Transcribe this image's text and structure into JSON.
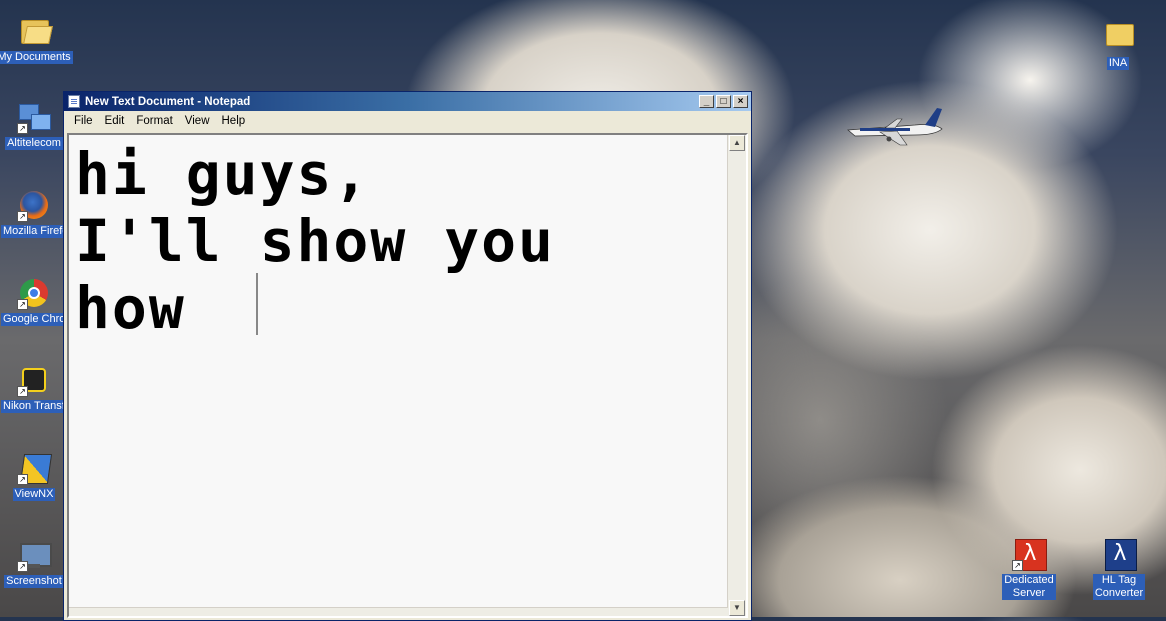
{
  "desktop": {
    "left_icons": [
      {
        "label": "My Documents",
        "icon": "folder-open-icon"
      },
      {
        "label": "Altitelecom",
        "icon": "network-icon"
      },
      {
        "label": "Mozilla Firefox",
        "icon": "firefox-icon"
      },
      {
        "label": "Google Chrome",
        "icon": "chrome-icon"
      },
      {
        "label": "Nikon Transfer",
        "icon": "nikon-transfer-icon"
      },
      {
        "label": "ViewNX",
        "icon": "viewnx-icon"
      },
      {
        "label": "Screenshot",
        "icon": "screenshot-icon"
      }
    ],
    "right_icons": [
      {
        "label": "INA",
        "icon": "folder-icon"
      },
      {
        "label_line1": "Dedicated",
        "label_line2": "Server",
        "icon": "half-life-dedicated-server-icon"
      },
      {
        "label_line1": "HL Tag",
        "label_line2": "Converter",
        "icon": "half-life-tag-converter-icon"
      }
    ]
  },
  "notepad": {
    "title": "New Text Document - Notepad",
    "window_buttons": {
      "minimize": "_",
      "maximize": "□",
      "close": "×"
    },
    "menu": [
      "File",
      "Edit",
      "Format",
      "View",
      "Help"
    ],
    "content_lines": [
      "hi guys,",
      "I'll show you",
      "how "
    ],
    "scroll_up": "▲",
    "scroll_down": "▼"
  },
  "colors": {
    "titlebar_start": "#0a246a",
    "titlebar_end": "#a6caf0",
    "icon_label_bg": "#2d5fb8"
  }
}
